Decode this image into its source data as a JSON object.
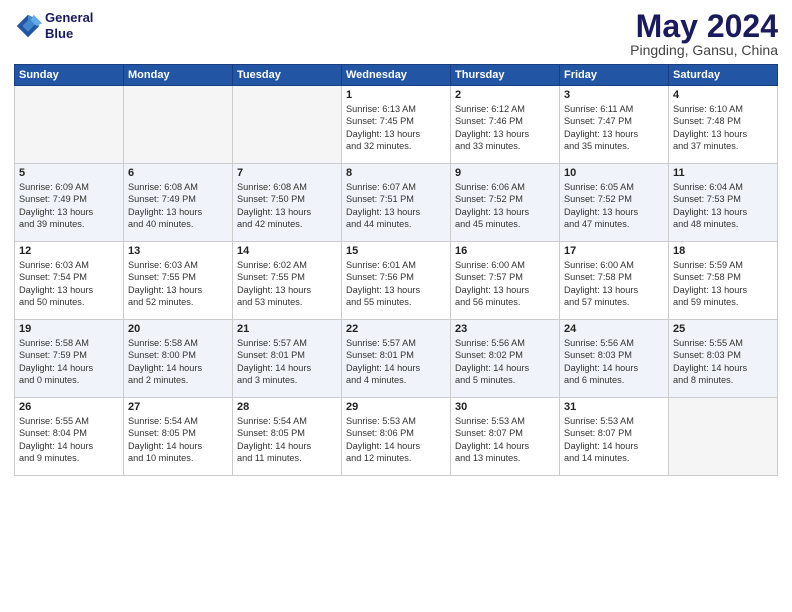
{
  "logo": {
    "line1": "General",
    "line2": "Blue"
  },
  "title": "May 2024",
  "subtitle": "Pingding, Gansu, China",
  "days_header": [
    "Sunday",
    "Monday",
    "Tuesday",
    "Wednesday",
    "Thursday",
    "Friday",
    "Saturday"
  ],
  "weeks": [
    [
      {
        "day": "",
        "text": ""
      },
      {
        "day": "",
        "text": ""
      },
      {
        "day": "",
        "text": ""
      },
      {
        "day": "1",
        "text": "Sunrise: 6:13 AM\nSunset: 7:45 PM\nDaylight: 13 hours\nand 32 minutes."
      },
      {
        "day": "2",
        "text": "Sunrise: 6:12 AM\nSunset: 7:46 PM\nDaylight: 13 hours\nand 33 minutes."
      },
      {
        "day": "3",
        "text": "Sunrise: 6:11 AM\nSunset: 7:47 PM\nDaylight: 13 hours\nand 35 minutes."
      },
      {
        "day": "4",
        "text": "Sunrise: 6:10 AM\nSunset: 7:48 PM\nDaylight: 13 hours\nand 37 minutes."
      }
    ],
    [
      {
        "day": "5",
        "text": "Sunrise: 6:09 AM\nSunset: 7:49 PM\nDaylight: 13 hours\nand 39 minutes."
      },
      {
        "day": "6",
        "text": "Sunrise: 6:08 AM\nSunset: 7:49 PM\nDaylight: 13 hours\nand 40 minutes."
      },
      {
        "day": "7",
        "text": "Sunrise: 6:08 AM\nSunset: 7:50 PM\nDaylight: 13 hours\nand 42 minutes."
      },
      {
        "day": "8",
        "text": "Sunrise: 6:07 AM\nSunset: 7:51 PM\nDaylight: 13 hours\nand 44 minutes."
      },
      {
        "day": "9",
        "text": "Sunrise: 6:06 AM\nSunset: 7:52 PM\nDaylight: 13 hours\nand 45 minutes."
      },
      {
        "day": "10",
        "text": "Sunrise: 6:05 AM\nSunset: 7:52 PM\nDaylight: 13 hours\nand 47 minutes."
      },
      {
        "day": "11",
        "text": "Sunrise: 6:04 AM\nSunset: 7:53 PM\nDaylight: 13 hours\nand 48 minutes."
      }
    ],
    [
      {
        "day": "12",
        "text": "Sunrise: 6:03 AM\nSunset: 7:54 PM\nDaylight: 13 hours\nand 50 minutes."
      },
      {
        "day": "13",
        "text": "Sunrise: 6:03 AM\nSunset: 7:55 PM\nDaylight: 13 hours\nand 52 minutes."
      },
      {
        "day": "14",
        "text": "Sunrise: 6:02 AM\nSunset: 7:55 PM\nDaylight: 13 hours\nand 53 minutes."
      },
      {
        "day": "15",
        "text": "Sunrise: 6:01 AM\nSunset: 7:56 PM\nDaylight: 13 hours\nand 55 minutes."
      },
      {
        "day": "16",
        "text": "Sunrise: 6:00 AM\nSunset: 7:57 PM\nDaylight: 13 hours\nand 56 minutes."
      },
      {
        "day": "17",
        "text": "Sunrise: 6:00 AM\nSunset: 7:58 PM\nDaylight: 13 hours\nand 57 minutes."
      },
      {
        "day": "18",
        "text": "Sunrise: 5:59 AM\nSunset: 7:58 PM\nDaylight: 13 hours\nand 59 minutes."
      }
    ],
    [
      {
        "day": "19",
        "text": "Sunrise: 5:58 AM\nSunset: 7:59 PM\nDaylight: 14 hours\nand 0 minutes."
      },
      {
        "day": "20",
        "text": "Sunrise: 5:58 AM\nSunset: 8:00 PM\nDaylight: 14 hours\nand 2 minutes."
      },
      {
        "day": "21",
        "text": "Sunrise: 5:57 AM\nSunset: 8:01 PM\nDaylight: 14 hours\nand 3 minutes."
      },
      {
        "day": "22",
        "text": "Sunrise: 5:57 AM\nSunset: 8:01 PM\nDaylight: 14 hours\nand 4 minutes."
      },
      {
        "day": "23",
        "text": "Sunrise: 5:56 AM\nSunset: 8:02 PM\nDaylight: 14 hours\nand 5 minutes."
      },
      {
        "day": "24",
        "text": "Sunrise: 5:56 AM\nSunset: 8:03 PM\nDaylight: 14 hours\nand 6 minutes."
      },
      {
        "day": "25",
        "text": "Sunrise: 5:55 AM\nSunset: 8:03 PM\nDaylight: 14 hours\nand 8 minutes."
      }
    ],
    [
      {
        "day": "26",
        "text": "Sunrise: 5:55 AM\nSunset: 8:04 PM\nDaylight: 14 hours\nand 9 minutes."
      },
      {
        "day": "27",
        "text": "Sunrise: 5:54 AM\nSunset: 8:05 PM\nDaylight: 14 hours\nand 10 minutes."
      },
      {
        "day": "28",
        "text": "Sunrise: 5:54 AM\nSunset: 8:05 PM\nDaylight: 14 hours\nand 11 minutes."
      },
      {
        "day": "29",
        "text": "Sunrise: 5:53 AM\nSunset: 8:06 PM\nDaylight: 14 hours\nand 12 minutes."
      },
      {
        "day": "30",
        "text": "Sunrise: 5:53 AM\nSunset: 8:07 PM\nDaylight: 14 hours\nand 13 minutes."
      },
      {
        "day": "31",
        "text": "Sunrise: 5:53 AM\nSunset: 8:07 PM\nDaylight: 14 hours\nand 14 minutes."
      },
      {
        "day": "",
        "text": ""
      }
    ]
  ]
}
